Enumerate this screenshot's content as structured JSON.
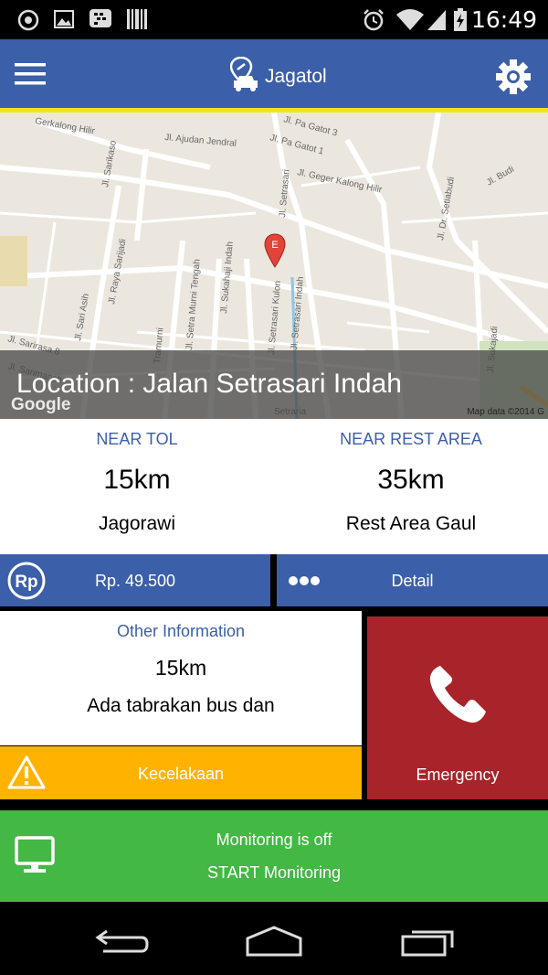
{
  "status_bar": {
    "time": "16:49"
  },
  "app_bar": {
    "title": "Jagatol"
  },
  "map": {
    "location": "Location : Jalan Setrasari Indah",
    "credit": "Map data ©2014 G",
    "logo": "Google",
    "streets": [
      "Gerkalong Hilir",
      "Jl. Ajudan Jendral",
      "Jl. Pa Gatot 3",
      "Jl. Pa Gatot 1",
      "Jl. Geger Kalong Hilir",
      "Jl. Sarikaso",
      "Jl. Raya Sarijadi",
      "Jl. Setrasari",
      "Jl. Sukahaji Indah",
      "Jl. Setra Murni Tengah",
      "Jl. Setrasari Indah",
      "Jl. Setrasari Kulon",
      "Jl. Dr. Setiabudi",
      "Jl. Sukajadi",
      "Jl. Budi",
      "Jl. Sarimanah",
      "Jl. Sarirasa 8",
      "Jl. Sari Asih",
      "Setraria",
      "Tramurni"
    ],
    "marker_label": "E"
  },
  "near_tol": {
    "label": "NEAR TOL",
    "distance": "15km",
    "name": "Jagorawi"
  },
  "near_rest": {
    "label": "NEAR REST AREA",
    "distance": "35km",
    "name": "Rest Area Gaul"
  },
  "price_button": {
    "icon": "Rp",
    "label": "Rp. 49.500"
  },
  "detail_button": {
    "label": "Detail"
  },
  "other_info": {
    "title": "Other Information",
    "distance": "15km",
    "description": "Ada tabrakan bus dan"
  },
  "incident_button": {
    "label": "Kecelakaan"
  },
  "emergency_button": {
    "label": "Emergency"
  },
  "monitoring": {
    "status": "Monitoring is off",
    "action": "START Monitoring"
  },
  "colors": {
    "primary": "#3b5fa8",
    "accent_yellow": "#f2e417",
    "warning": "#ffb300",
    "emergency": "#a8242a",
    "success": "#43b845"
  }
}
